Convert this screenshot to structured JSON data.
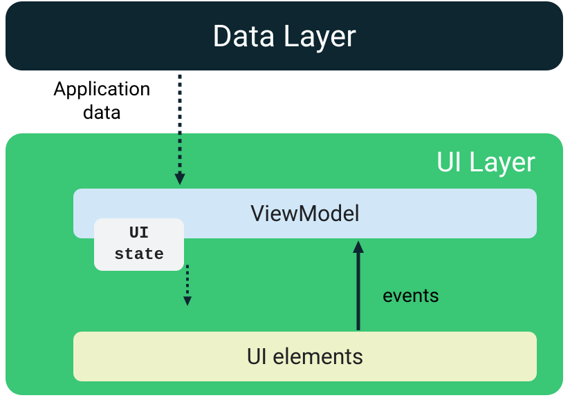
{
  "diagram": {
    "dataLayer": "Data Layer",
    "appDataLabel": "Application\ndata",
    "uiLayer": "UI Layer",
    "viewModel": "ViewModel",
    "uiState": "UI\nstate",
    "uiElements": "UI elements",
    "events": "events"
  },
  "colors": {
    "dataLayerBg": "#0d2630",
    "uiLayerBg": "#3ac776",
    "viewModelBg": "#d1e7f7",
    "uiStateBg": "#f1f3f4",
    "uiElementsBg": "#eef2c8",
    "arrowColor": "#0d2630"
  }
}
